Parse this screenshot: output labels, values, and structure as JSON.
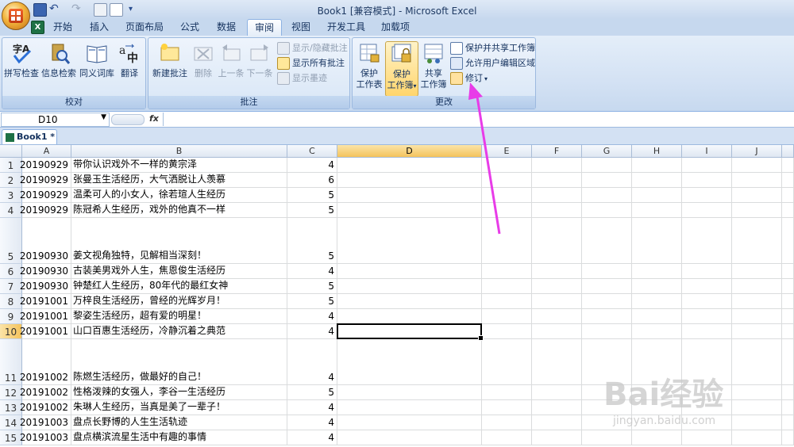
{
  "window": {
    "title": "Book1  [兼容模式] - Microsoft Excel"
  },
  "tabs": [
    "开始",
    "插入",
    "页面布局",
    "公式",
    "数据",
    "审阅",
    "视图",
    "开发工具",
    "加载项"
  ],
  "active_tab": "审阅",
  "ribbon": {
    "proofing": {
      "label": "校对",
      "spell": "拼写检查",
      "research": "信息检索",
      "thesaurus": "同义词库",
      "translate": "翻译"
    },
    "comments": {
      "label": "批注",
      "new": "新建批注",
      "delete": "删除",
      "prev": "上一条",
      "next": "下一条",
      "toggle": "显示/隐藏批注",
      "show_all": "显示所有批注",
      "show_ink": "显示墨迹"
    },
    "changes": {
      "label": "更改",
      "protect_sheet": [
        "保护",
        "工作表"
      ],
      "protect_workbook": [
        "保护",
        "工作簿"
      ],
      "share_workbook": [
        "共享",
        "工作簿"
      ],
      "protect_share": "保护并共享工作簿",
      "allow_edit": "允许用户编辑区域",
      "track": "修订"
    }
  },
  "formula_bar": {
    "name_box": "D10",
    "fx": "fx",
    "value": ""
  },
  "doc_tab": "Book1 *",
  "columns": [
    "A",
    "B",
    "C",
    "D",
    "E",
    "F",
    "G",
    "H",
    "I",
    "J"
  ],
  "selected_column": "D",
  "selected_row": "10",
  "rows": [
    {
      "n": "1",
      "a": "20190929",
      "b": "带你认识戏外不一样的黄宗泽",
      "c": "4"
    },
    {
      "n": "2",
      "a": "20190929",
      "b": "张曼玉生活经历，大气洒脱让人羡慕",
      "c": "6"
    },
    {
      "n": "3",
      "a": "20190929",
      "b": "温柔可人的小女人，徐若瑄人生经历",
      "c": "5"
    },
    {
      "n": "4",
      "a": "20190929",
      "b": "陈冠希人生经历，戏外的他真不一样",
      "c": "5"
    },
    {
      "n": "5",
      "a": "20190930",
      "b": "姜文视角独特，见解相当深刻！",
      "c": "5"
    },
    {
      "n": "6",
      "a": "20190930",
      "b": "古装美男戏外人生，焦恩俊生活经历",
      "c": "4"
    },
    {
      "n": "7",
      "a": "20190930",
      "b": "钟楚红人生经历，80年代的最红女神",
      "c": "5"
    },
    {
      "n": "8",
      "a": "20191001",
      "b": "万梓良生活经历，曾经的光辉岁月！",
      "c": "5"
    },
    {
      "n": "9",
      "a": "20191001",
      "b": "黎姿生活经历，超有爱的明星！",
      "c": "4"
    },
    {
      "n": "10",
      "a": "20191001",
      "b": "山口百惠生活经历，冷静沉着之典范",
      "c": "4"
    },
    {
      "n": "11",
      "a": "20191002",
      "b": "陈燃生活经历，做最好的自己！",
      "c": "4"
    },
    {
      "n": "12",
      "a": "20191002",
      "b": "性格泼辣的女强人，李谷一生活经历",
      "c": "5"
    },
    {
      "n": "13",
      "a": "20191002",
      "b": "朱琳人生经历，当真是美了一辈子！",
      "c": "4"
    },
    {
      "n": "14",
      "a": "20191003",
      "b": "盘点长野博的人生生活轨迹",
      "c": "4"
    },
    {
      "n": "15",
      "a": "20191003",
      "b": "盘点横滨流星生活中有趣的事情",
      "c": "4"
    }
  ],
  "watermark": {
    "logo": "Bai经验",
    "url": "jingyan.baidu.com"
  },
  "colors": {
    "accent_arrow": "#e83ce8",
    "selection_header": "#f4c35c",
    "ribbon_blue": "#15325e"
  }
}
